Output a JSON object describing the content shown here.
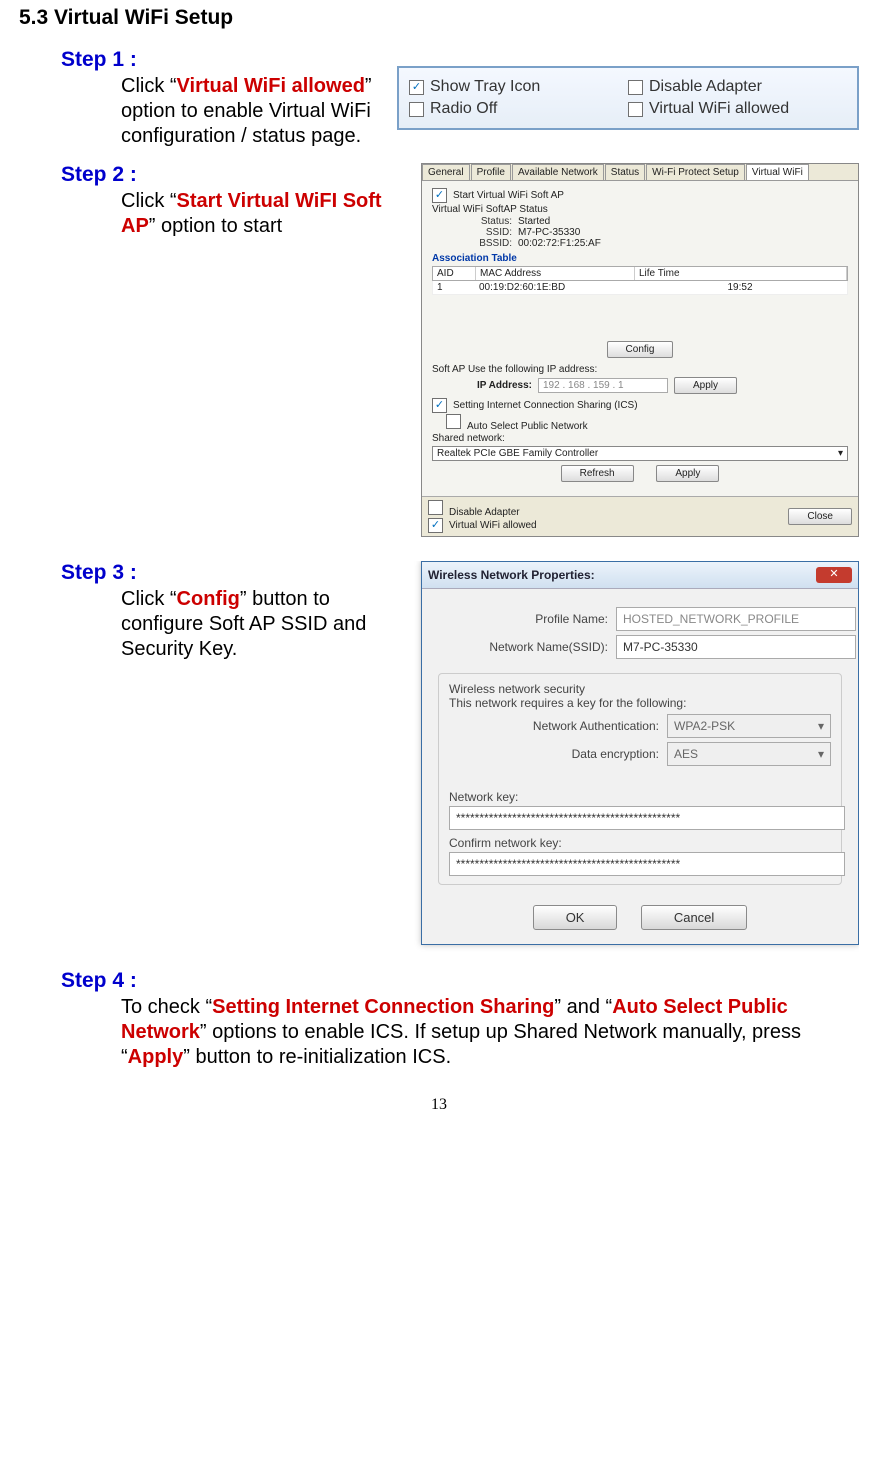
{
  "section_title": "5.3 Virtual WiFi Setup",
  "step1": {
    "label": "Step 1 :",
    "t1": "Click “",
    "hl": "Virtual WiFi allowed",
    "t2": "” option to enable Virtual WiFi configuration / status page."
  },
  "panel1": {
    "showTray": "Show Tray Icon",
    "disableAdapter": "Disable Adapter",
    "radioOff": "Radio Off",
    "virtualWifi": "Virtual WiFi allowed"
  },
  "step2": {
    "label": "Step 2 :",
    "t1": "Click “",
    "hl": "Start Virtual WiFI Soft AP",
    "t2": "” option to start"
  },
  "panel2": {
    "tabs": [
      "General",
      "Profile",
      "Available Network",
      "Status",
      "Wi-Fi Protect Setup",
      "Virtual WiFi"
    ],
    "startSoftAP": "Start Virtual WiFi Soft AP",
    "statusHeader": "Virtual WiFi SoftAP Status",
    "status_k": "Status:",
    "status_v": "Started",
    "ssid_k": "SSID:",
    "ssid_v": "M7-PC-35330",
    "bssid_k": "BSSID:",
    "bssid_v": "00:02:72:F1:25:AF",
    "assocTable": "Association Table",
    "thead": [
      "AID",
      "MAC Address",
      "Life Time"
    ],
    "trow": [
      "1",
      "00:19:D2:60:1E:BD",
      "19:52"
    ],
    "configBtn": "Config",
    "ipLine": "Soft AP Use the following IP address:",
    "ipLabel": "IP Address:",
    "ipVal": "192 . 168 . 159 .   1",
    "applyBtn": "Apply",
    "ics": "Setting Internet Connection Sharing (ICS)",
    "autoSel": "Auto Select Public Network",
    "sharedNet": "Shared network:",
    "sharedSel": "Realtek PCIe GBE Family Controller",
    "refreshBtn": "Refresh",
    "applyBtn2": "Apply",
    "disableAdapter": "Disable Adapter",
    "virtualWifi": "Virtual WiFi allowed",
    "closeBtn": "Close"
  },
  "step3": {
    "label": "Step 3 :",
    "t1": "Click “",
    "hl": "Config",
    "t2": "” button to configure Soft AP SSID and Security Key."
  },
  "panel3": {
    "title": "Wireless Network Properties:",
    "profileName_l": "Profile Name:",
    "profileName_v": "HOSTED_NETWORK_PROFILE",
    "ssid_l": "Network Name(SSID):",
    "ssid_v": "M7-PC-35330",
    "secTitle": "Wireless network security",
    "secLine": "This network requires a key for the following:",
    "auth_l": "Network Authentication:",
    "auth_v": "WPA2-PSK",
    "enc_l": "Data encryption:",
    "enc_v": "AES",
    "key_l": "Network key:",
    "key_v": "************************************************",
    "ckey_l": "Confirm network key:",
    "ckey_v": "************************************************",
    "ok": "OK",
    "cancel": "Cancel"
  },
  "step4": {
    "label": "Step 4 :",
    "t1": "To check “",
    "hl1": "Setting Internet Connection Sharing",
    "t2": "” and “",
    "hl2": "Auto Select Public Network",
    "t3": "” options to enable ICS. If setup up Shared Network manually, press “",
    "hl3": "Apply",
    "t4": "” button to re-initialization ICS."
  },
  "pageNum": "13"
}
